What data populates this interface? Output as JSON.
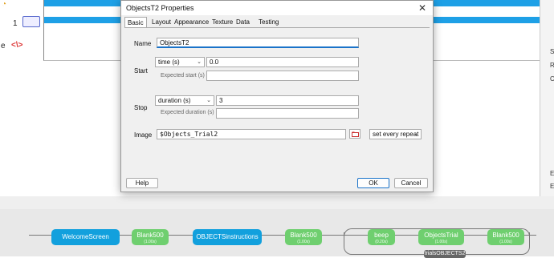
{
  "background": {
    "left_labels": [
      "1",
      "e"
    ],
    "right_panel_letters": [
      "S",
      "R",
      "C",
      "E",
      "E"
    ],
    "routine_flow": {
      "nodes": [
        {
          "label": "WelcomeScreen",
          "kind": "routine",
          "sub": ""
        },
        {
          "label": "Blank500",
          "kind": "static",
          "sub": "(1.00s)"
        },
        {
          "label": "OBJECTSinstructions",
          "kind": "routine",
          "sub": ""
        },
        {
          "label": "Blank500",
          "kind": "static",
          "sub": "(1.00s)"
        },
        {
          "label": "beep",
          "kind": "static",
          "sub": "(0.20s)"
        },
        {
          "label": "ObjectsTrial",
          "kind": "static",
          "sub": "(1.00s)"
        },
        {
          "label": "Blank500",
          "kind": "static",
          "sub": "(1.00s)"
        }
      ],
      "loop_label": "trialsOBJECTS2"
    }
  },
  "dialog": {
    "title": "ObjectsT2 Properties",
    "tabs": [
      {
        "label": "Basic",
        "active": true
      },
      {
        "label": "Layout",
        "active": false
      },
      {
        "label": "Appearance",
        "active": false
      },
      {
        "label": "Texture",
        "active": false
      },
      {
        "label": "Data",
        "active": false
      },
      {
        "label": "Testing",
        "active": false
      }
    ],
    "name": {
      "label": "Name",
      "value": "ObjectsT2"
    },
    "start": {
      "label": "Start",
      "type_value": "time (s)",
      "value": "0.0",
      "expected_label": "Expected start (s)",
      "expected_value": ""
    },
    "stop": {
      "label": "Stop",
      "type_value": "duration (s)",
      "value": "3",
      "expected_label": "Expected duration (s)",
      "expected_value": ""
    },
    "image": {
      "label": "Image",
      "value": "$Objects_Trial2",
      "update_value": "set every repeat"
    },
    "buttons": {
      "help": "Help",
      "ok": "OK",
      "cancel": "Cancel"
    }
  },
  "colors": {
    "routine_blue": "#12a0dd",
    "static_green": "#6fcf6f",
    "accent": "#1a73c9"
  }
}
